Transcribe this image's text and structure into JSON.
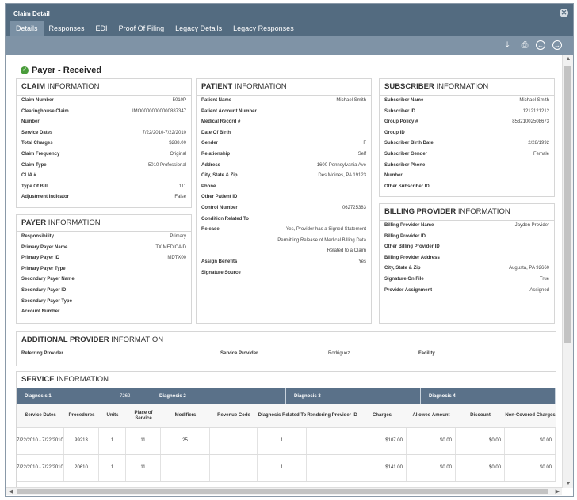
{
  "window": {
    "title": "Claim Detail"
  },
  "tabs": [
    "Details",
    "Responses",
    "EDI",
    "Proof Of Filing",
    "Legacy Details",
    "Legacy Responses"
  ],
  "status": "Payer - Received",
  "claim": {
    "title_bold": "CLAIM",
    "title_rest": " INFORMATION",
    "rows": [
      {
        "label": "Claim Number",
        "value": "5010P"
      },
      {
        "label": "Clearinghouse Claim",
        "value": "IMO00000000000887347"
      },
      {
        "label": "Number",
        "value": ""
      },
      {
        "label": "Service Dates",
        "value": "7/22/2010-7/22/2010"
      },
      {
        "label": "Total Charges",
        "value": "$288.00"
      },
      {
        "label": "Claim Frequency",
        "value": "Original"
      },
      {
        "label": "Claim Type",
        "value": "5010 Professional"
      },
      {
        "label": "CLIA #",
        "value": ""
      },
      {
        "label": "Type Of Bill",
        "value": "111"
      },
      {
        "label": "Adjustment Indicator",
        "value": "False"
      }
    ]
  },
  "patient": {
    "title_bold": "PATIENT",
    "title_rest": " INFORMATION",
    "rows": [
      {
        "label": "Patient Name",
        "value": "Michael Smith"
      },
      {
        "label": "Patient Account Number",
        "value": ""
      },
      {
        "label": "Medical Record #",
        "value": ""
      },
      {
        "label": "Date Of Birth",
        "value": ""
      },
      {
        "label": "Gender",
        "value": "F"
      },
      {
        "label": "Relationship",
        "value": "Self"
      },
      {
        "label": "Address",
        "value": "1600 Pennsylvania Ave"
      },
      {
        "label": "City, State & Zip",
        "value": "Des Moines, PA 19123"
      },
      {
        "label": "Phone",
        "value": ""
      },
      {
        "label": "Other Patient ID",
        "value": ""
      },
      {
        "label": "Control Number",
        "value": "062725383"
      },
      {
        "label": "Condition Related To",
        "value": ""
      },
      {
        "label": "Release",
        "value": "Yes, Provider has a Signed Statement"
      },
      {
        "label": "",
        "value": "Permitting Release of Medical Billing Data"
      },
      {
        "label": "",
        "value": "Related to a Claim"
      },
      {
        "label": "Assign Benefits",
        "value": "Yes"
      },
      {
        "label": "Signature Source",
        "value": ""
      }
    ]
  },
  "subscriber": {
    "title_bold": "SUBSCRIBER",
    "title_rest": " INFORMATION",
    "rows": [
      {
        "label": "Subscriber Name",
        "value": "Michael Smith"
      },
      {
        "label": "Subscriber ID",
        "value": "1212121212"
      },
      {
        "label": "Group Policy #",
        "value": "85321002508673"
      },
      {
        "label": "Group ID",
        "value": ""
      },
      {
        "label": "Subscriber Birth Date",
        "value": "2/28/1992"
      },
      {
        "label": "Subscriber Gender",
        "value": "Female"
      },
      {
        "label": "Subscriber Phone",
        "value": ""
      },
      {
        "label": "Number",
        "value": ""
      },
      {
        "label": "Other Subscriber ID",
        "value": ""
      }
    ]
  },
  "payer": {
    "title_bold": "PAYER",
    "title_rest": " INFORMATION",
    "rows": [
      {
        "label": "Responsibility",
        "value": "Primary"
      },
      {
        "label": "Primary Payer Name",
        "value": "TX MEDICAID"
      },
      {
        "label": "Primary Payer ID",
        "value": "MDTX00"
      },
      {
        "label": "Primary Payer Type",
        "value": ""
      },
      {
        "label": "Secondary Payer Name",
        "value": ""
      },
      {
        "label": "Secondary Payer ID",
        "value": ""
      },
      {
        "label": "Secondary Payer Type",
        "value": ""
      },
      {
        "label": "Account Number",
        "value": ""
      }
    ]
  },
  "billing": {
    "title_bold": "BILLING PROVIDER",
    "title_rest": " INFORMATION",
    "rows": [
      {
        "label": "Billing Provider Name",
        "value": "Jayden Provider"
      },
      {
        "label": "Billing Provider ID",
        "value": ""
      },
      {
        "label": "Other Billing Provider ID",
        "value": ""
      },
      {
        "label": "Billing Provider Address",
        "value": ""
      },
      {
        "label": "City, State & Zip",
        "value": "Augusta, PA 92660"
      },
      {
        "label": "Signature On File",
        "value": "True"
      },
      {
        "label": "Provider Assignment",
        "value": "Assigned"
      }
    ]
  },
  "additional": {
    "title_bold": "ADDITIONAL PROVIDER",
    "title_rest": " INFORMATION",
    "referring_label": "Referring Provider",
    "service_label": "Service Provider",
    "service_value": "Rodriguez",
    "facility_label": "Facility"
  },
  "service": {
    "title_bold": "SERVICE",
    "title_rest": " INFORMATION",
    "diagnoses": [
      {
        "label": "Diagnosis 1",
        "value": "7262"
      },
      {
        "label": "Diagnosis 2",
        "value": ""
      },
      {
        "label": "Diagnosis 3",
        "value": ""
      },
      {
        "label": "Diagnosis 4",
        "value": ""
      }
    ],
    "columns": [
      "Service Dates",
      "Procedures",
      "Units",
      "Place of Service",
      "Modifiers",
      "Revenue Code",
      "Diagnosis Related To",
      "Rendering Provider ID",
      "Charges",
      "Allowed Amount",
      "Discount",
      "Non-Covered Charges"
    ],
    "rows": [
      [
        "7/22/2010 - 7/22/2010",
        "99213",
        "1",
        "11",
        "25",
        "",
        "1",
        "",
        "$107.00",
        "$0.00",
        "$0.00",
        "$0.00"
      ],
      [
        "7/22/2010 - 7/22/2010",
        "20610",
        "1",
        "11",
        "",
        "",
        "1",
        "",
        "$141.00",
        "$0.00",
        "$0.00",
        "$0.00"
      ]
    ]
  }
}
